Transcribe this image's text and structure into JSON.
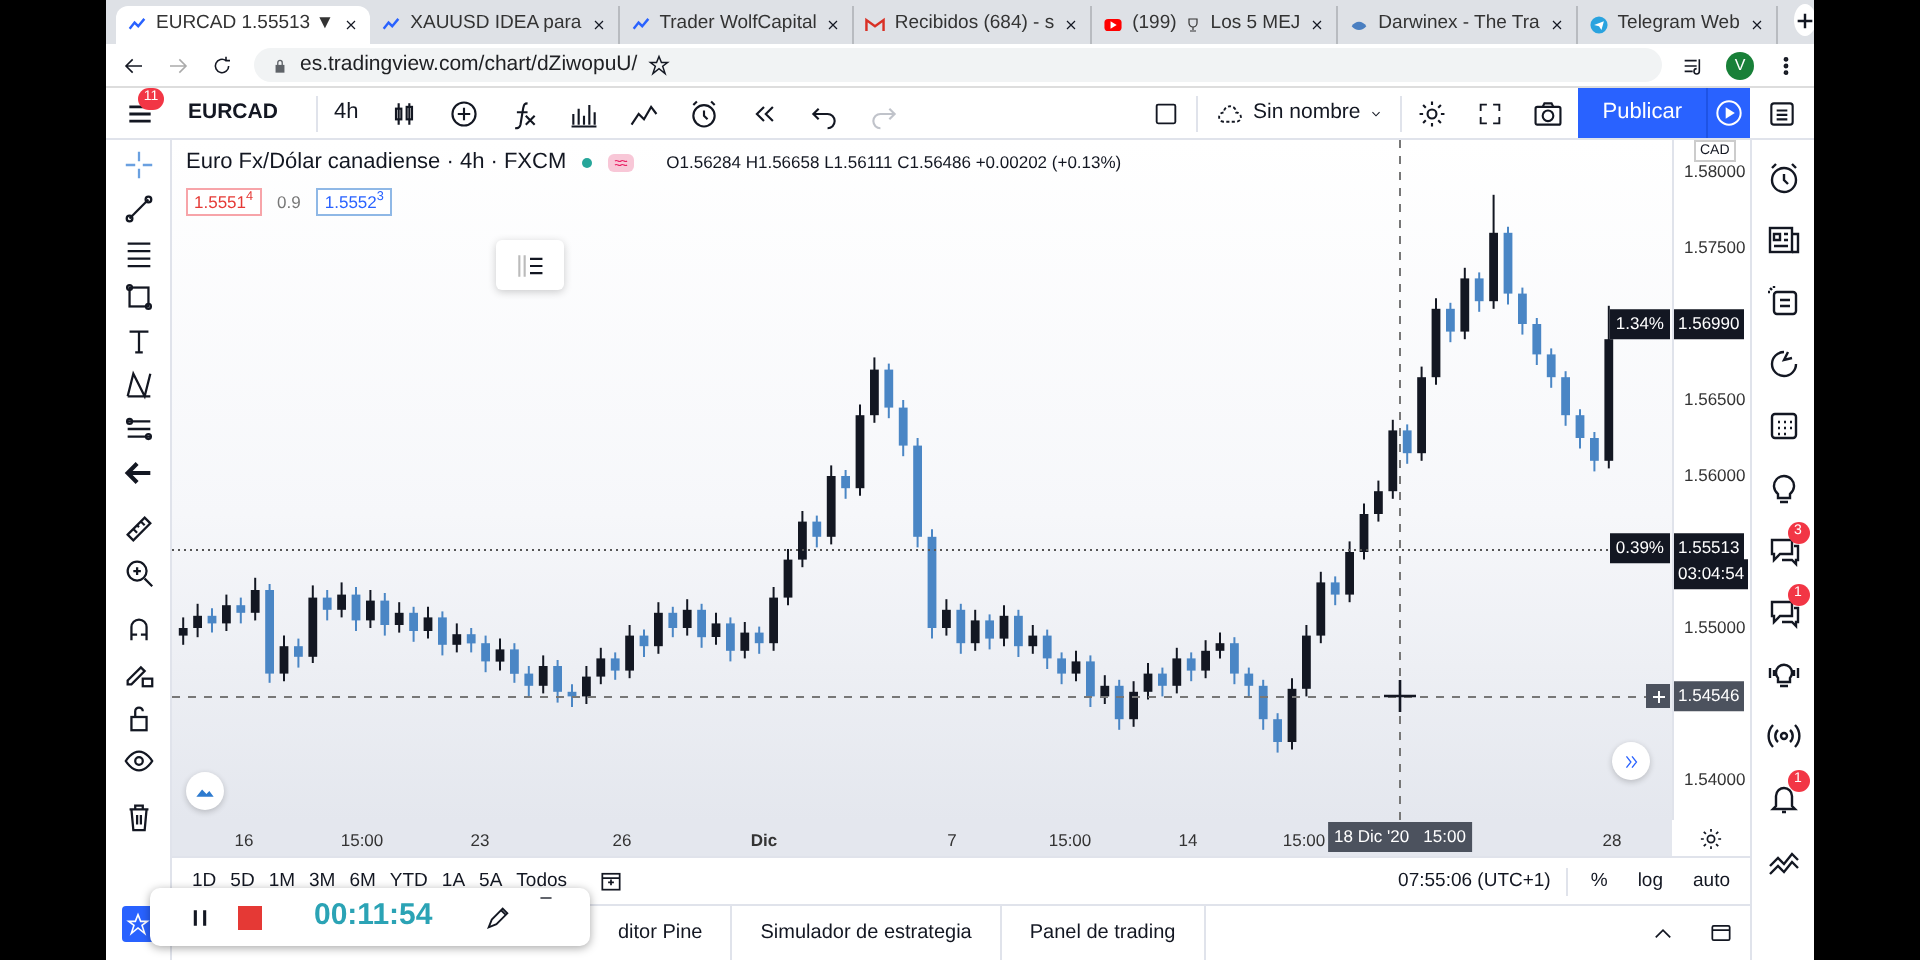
{
  "browser": {
    "tabs": [
      {
        "kind": "tradingview",
        "title": "EURCAD 1.55513 ▼",
        "selected": true
      },
      {
        "kind": "tradingview",
        "title": "XAUUSD IDEA para",
        "selected": false
      },
      {
        "kind": "tradingview",
        "title": "Trader WolfCapital",
        "selected": false
      },
      {
        "kind": "mail",
        "title": "Recibidos (684) - s",
        "selected": false
      },
      {
        "kind": "video",
        "title": "(199)",
        "title_after_icon": "Los 5 MEJ",
        "selected": false
      },
      {
        "kind": "bird",
        "title": "Darwinex - The Tra",
        "selected": false
      },
      {
        "kind": "telegram",
        "title": "Telegram Web",
        "selected": false
      }
    ],
    "url": "es.tradingview.com/chart/dZiwopuU/",
    "profile_initial": "V"
  },
  "toolbar": {
    "notifications": "11",
    "symbol": "EURCAD",
    "interval": "4h",
    "layout_name": "Sin nombre",
    "publish": "Publicar"
  },
  "legend": {
    "title": "Euro Fx/Dólar canadiense · 4h · FXCM",
    "ohlc": "O1.56284 H1.56658 L1.56111 C1.56486 +0.00202 (+0.13%)",
    "bid": "1.5551$^{4}$",
    "spread": "0.9",
    "ask": "1.5552$^{3}$"
  },
  "chart": {
    "chart_data": {
      "type": "candlestick",
      "ylim": [
        1.53737,
        1.58211
      ],
      "ref_lines": [
        {
          "value": 1.55513,
          "axis": "y"
        }
      ],
      "yticks": [
        {
          "value": 1.58,
          "label": "1.58000"
        },
        {
          "value": 1.575,
          "label": "1.57500"
        },
        {
          "value": 1.565,
          "label": "1.56500"
        },
        {
          "value": 1.56,
          "label": "1.56000"
        },
        {
          "value": 1.55,
          "label": "1.55000"
        },
        {
          "value": 1.54,
          "label": "1.54000"
        }
      ],
      "categories": [
        null,
        null,
        null,
        null,
        null,
        null,
        null,
        null,
        null,
        null,
        null,
        null,
        null,
        null,
        null,
        null,
        null,
        null,
        null,
        null,
        null,
        null,
        null,
        null,
        null,
        null,
        null,
        null,
        null,
        null,
        null,
        null,
        null,
        null,
        null,
        null,
        null,
        null,
        null,
        null,
        null,
        null,
        null,
        null,
        null,
        null,
        null,
        null,
        null,
        null,
        null,
        null,
        null,
        null,
        null,
        null,
        null,
        null,
        null,
        null,
        null,
        null,
        null,
        null,
        null,
        null,
        null,
        null,
        null,
        null,
        null,
        null,
        null,
        null,
        null,
        null,
        null,
        null,
        null,
        null,
        null,
        null,
        null,
        null,
        null,
        null,
        null,
        null,
        null,
        null,
        null,
        null,
        null,
        null,
        null,
        null,
        null,
        null,
        null,
        null
      ],
      "ohlc": [
        [
          1.5495,
          1.5507,
          1.5489,
          1.55
        ],
        [
          1.55,
          1.5516,
          1.5494,
          1.5508
        ],
        [
          1.5508,
          1.5513,
          1.5497,
          1.5503
        ],
        [
          1.5503,
          1.5522,
          1.5498,
          1.5515
        ],
        [
          1.5515,
          1.552,
          1.5503,
          1.551
        ],
        [
          1.551,
          1.5533,
          1.5505,
          1.5525
        ],
        [
          1.5525,
          1.5529,
          1.5464,
          1.547
        ],
        [
          1.547,
          1.5495,
          1.5465,
          1.5488
        ],
        [
          1.5488,
          1.5493,
          1.5474,
          1.5481
        ],
        [
          1.5481,
          1.5528,
          1.5477,
          1.552
        ],
        [
          1.552,
          1.5525,
          1.5505,
          1.5512
        ],
        [
          1.5512,
          1.553,
          1.5507,
          1.5522
        ],
        [
          1.5522,
          1.5527,
          1.5498,
          1.5505
        ],
        [
          1.5505,
          1.5525,
          1.55,
          1.5518
        ],
        [
          1.5518,
          1.5523,
          1.5495,
          1.5502
        ],
        [
          1.5502,
          1.5517,
          1.5497,
          1.551
        ],
        [
          1.551,
          1.5514,
          1.5491,
          1.5498
        ],
        [
          1.5498,
          1.5514,
          1.5493,
          1.5507
        ],
        [
          1.5507,
          1.5511,
          1.5482,
          1.5489
        ],
        [
          1.5489,
          1.5503,
          1.5484,
          1.5496
        ],
        [
          1.5496,
          1.55,
          1.5484,
          1.549
        ],
        [
          1.549,
          1.5495,
          1.5471,
          1.5478
        ],
        [
          1.5478,
          1.5493,
          1.5472,
          1.5486
        ],
        [
          1.5486,
          1.549,
          1.5464,
          1.547
        ],
        [
          1.547,
          1.5475,
          1.5455,
          1.5462
        ],
        [
          1.5462,
          1.5482,
          1.5457,
          1.5475
        ],
        [
          1.5475,
          1.5479,
          1.5451,
          1.5458
        ],
        [
          1.5458,
          1.5463,
          1.5448,
          1.5455
        ],
        [
          1.5455,
          1.5475,
          1.545,
          1.5468
        ],
        [
          1.5468,
          1.5487,
          1.5463,
          1.548
        ],
        [
          1.548,
          1.5484,
          1.5466,
          1.5472
        ],
        [
          1.5472,
          1.5502,
          1.5467,
          1.5495
        ],
        [
          1.5495,
          1.5499,
          1.5481,
          1.5488
        ],
        [
          1.5488,
          1.5517,
          1.5483,
          1.551
        ],
        [
          1.551,
          1.5514,
          1.5494,
          1.55
        ],
        [
          1.55,
          1.5519,
          1.5495,
          1.5512
        ],
        [
          1.5512,
          1.5516,
          1.5487,
          1.5494
        ],
        [
          1.5494,
          1.551,
          1.5489,
          1.5503
        ],
        [
          1.5503,
          1.5507,
          1.5478,
          1.5485
        ],
        [
          1.5485,
          1.5504,
          1.548,
          1.5497
        ],
        [
          1.5497,
          1.5501,
          1.5483,
          1.549
        ],
        [
          1.549,
          1.5527,
          1.5485,
          1.552
        ],
        [
          1.552,
          1.5552,
          1.5515,
          1.5545
        ],
        [
          1.5545,
          1.5577,
          1.554,
          1.557
        ],
        [
          1.557,
          1.5574,
          1.5553,
          1.556
        ],
        [
          1.556,
          1.5607,
          1.5555,
          1.56
        ],
        [
          1.56,
          1.5604,
          1.5585,
          1.5592
        ],
        [
          1.5592,
          1.5647,
          1.5587,
          1.564
        ],
        [
          1.564,
          1.5678,
          1.5635,
          1.567
        ],
        [
          1.567,
          1.5674,
          1.5638,
          1.5645
        ],
        [
          1.5645,
          1.565,
          1.5613,
          1.562
        ],
        [
          1.562,
          1.5625,
          1.5553,
          1.556
        ],
        [
          1.556,
          1.5565,
          1.5493,
          1.55
        ],
        [
          1.55,
          1.5519,
          1.5495,
          1.5512
        ],
        [
          1.5512,
          1.5516,
          1.5483,
          1.549
        ],
        [
          1.549,
          1.5512,
          1.5485,
          1.5505
        ],
        [
          1.5505,
          1.5509,
          1.5486,
          1.5493
        ],
        [
          1.5493,
          1.5515,
          1.5488,
          1.5508
        ],
        [
          1.5508,
          1.5512,
          1.5481,
          1.5488
        ],
        [
          1.5488,
          1.5502,
          1.5483,
          1.5495
        ],
        [
          1.5495,
          1.5499,
          1.5473,
          1.548
        ],
        [
          1.548,
          1.5484,
          1.5463,
          1.547
        ],
        [
          1.547,
          1.5485,
          1.5465,
          1.5478
        ],
        [
          1.5478,
          1.5482,
          1.5448,
          1.5455
        ],
        [
          1.5455,
          1.5469,
          1.545,
          1.5462
        ],
        [
          1.5462,
          1.5466,
          1.5433,
          1.544
        ],
        [
          1.544,
          1.5465,
          1.5435,
          1.5458
        ],
        [
          1.5458,
          1.5477,
          1.5453,
          1.547
        ],
        [
          1.547,
          1.5474,
          1.5455,
          1.5462
        ],
        [
          1.5462,
          1.5487,
          1.5457,
          1.548
        ],
        [
          1.548,
          1.5484,
          1.5465,
          1.5472
        ],
        [
          1.5472,
          1.5492,
          1.5467,
          1.5485
        ],
        [
          1.5485,
          1.5497,
          1.548,
          1.549
        ],
        [
          1.549,
          1.5494,
          1.5463,
          1.547
        ],
        [
          1.547,
          1.5474,
          1.5455,
          1.5462
        ],
        [
          1.5462,
          1.5466,
          1.5433,
          1.544
        ],
        [
          1.544,
          1.5444,
          1.5418,
          1.5425
        ],
        [
          1.5425,
          1.5467,
          1.542,
          1.546
        ],
        [
          1.546,
          1.5502,
          1.5455,
          1.5495
        ],
        [
          1.5495,
          1.5537,
          1.549,
          1.553
        ],
        [
          1.553,
          1.5534,
          1.5515,
          1.5522
        ],
        [
          1.5522,
          1.5557,
          1.5517,
          1.555
        ],
        [
          1.555,
          1.5582,
          1.5545,
          1.5575
        ],
        [
          1.5575,
          1.5597,
          1.557,
          1.559
        ],
        [
          1.559,
          1.5637,
          1.5585,
          1.563
        ],
        [
          1.563,
          1.5634,
          1.5608,
          1.5615
        ],
        [
          1.5615,
          1.5672,
          1.561,
          1.5665
        ],
        [
          1.5665,
          1.5717,
          1.566,
          1.571
        ],
        [
          1.571,
          1.5714,
          1.5688,
          1.5695
        ],
        [
          1.5695,
          1.5737,
          1.569,
          1.573
        ],
        [
          1.573,
          1.5734,
          1.5708,
          1.5715
        ],
        [
          1.5715,
          1.5785,
          1.571,
          1.576
        ],
        [
          1.576,
          1.5764,
          1.5713,
          1.572
        ],
        [
          1.572,
          1.5724,
          1.5693,
          1.57
        ],
        [
          1.57,
          1.5704,
          1.5673,
          1.568
        ],
        [
          1.568,
          1.5684,
          1.5658,
          1.5665
        ],
        [
          1.5665,
          1.5669,
          1.5633,
          1.564
        ],
        [
          1.564,
          1.5644,
          1.5618,
          1.5625
        ],
        [
          1.5625,
          1.5629,
          1.5603,
          1.561
        ],
        [
          1.561,
          1.5712,
          1.5605,
          1.569
        ]
      ]
    }
  },
  "price_axis": {
    "currency": "CAD",
    "tags": [
      {
        "kind": "last",
        "change": "1.34%",
        "price": "1.56990"
      },
      {
        "kind": "current",
        "change": "0.39%",
        "price": "1.55513",
        "countdown": "03:04:54"
      },
      {
        "kind": "crosshair",
        "price": "1.54546"
      }
    ]
  },
  "time_axis": {
    "labels": [
      {
        "text": "16",
        "kind": "day"
      },
      {
        "text": "15:00",
        "kind": "time"
      },
      {
        "text": "23",
        "kind": "day"
      },
      {
        "text": "26",
        "kind": "day"
      },
      {
        "text": "Dic",
        "kind": "month"
      },
      {
        "text": "7",
        "kind": "day"
      },
      {
        "text": "15:00",
        "kind": "time"
      },
      {
        "text": "14",
        "kind": "day"
      },
      {
        "text": "15:00",
        "kind": "time"
      },
      {
        "text": "28",
        "kind": "day"
      }
    ],
    "crosshair": "18 Dic '20   15:00"
  },
  "ranges": [
    "1D",
    "5D",
    "1M",
    "3M",
    "6M",
    "YTD",
    "1A",
    "5A",
    "Todos"
  ],
  "clock": "07:55:06 (UTC+1)",
  "scale_buttons": [
    "%",
    "log",
    "auto"
  ],
  "bottom_tabs": [
    "ditor Pine",
    "Simulador de estrategia",
    "Panel de trading"
  ],
  "recorder": {
    "time": "00:11:54"
  },
  "sidebar": [
    {
      "kind": "alarm"
    },
    {
      "kind": "news"
    },
    {
      "kind": "datawindow"
    },
    {
      "kind": "hotlist"
    },
    {
      "kind": "calendar"
    },
    {
      "kind": "ideas"
    },
    {
      "kind": "chat",
      "badge": "3"
    },
    {
      "kind": "chat",
      "badge": "1"
    },
    {
      "kind": "streams"
    },
    {
      "kind": "broadcast"
    },
    {
      "kind": "bell",
      "badge": "1"
    },
    {
      "kind": "trend"
    }
  ]
}
